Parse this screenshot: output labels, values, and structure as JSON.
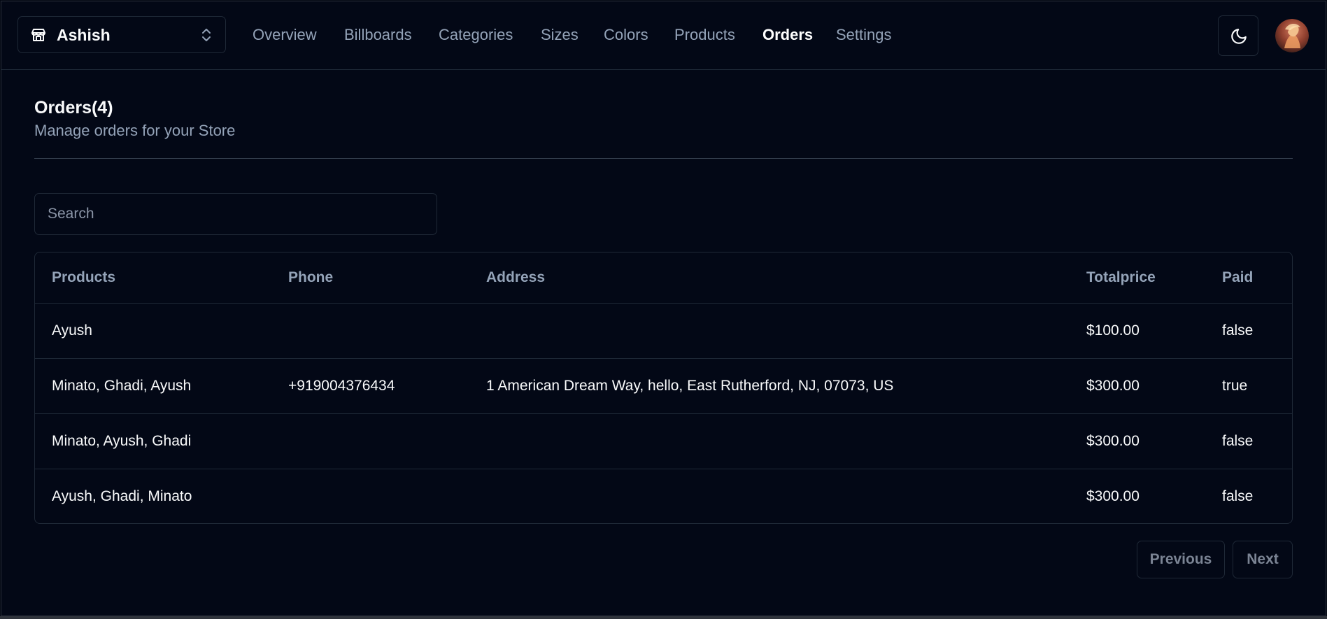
{
  "store_switcher": {
    "name": "Ashish",
    "icon": "store-icon",
    "chevron_icon": "chevrons-up-down-icon"
  },
  "nav": {
    "items": [
      {
        "label": "Overview",
        "active": false
      },
      {
        "label": "Billboards",
        "active": false
      },
      {
        "label": "Categories",
        "active": false
      },
      {
        "label": "Sizes",
        "active": false
      },
      {
        "label": "Colors",
        "active": false
      },
      {
        "label": "Products",
        "active": false
      },
      {
        "label": "Orders",
        "active": true
      },
      {
        "label": "Settings",
        "active": false
      }
    ]
  },
  "header_actions": {
    "theme_icon": "moon-icon",
    "avatar_icon": "user-avatar"
  },
  "heading": {
    "title": "Orders(4)",
    "subtitle": "Manage orders for your Store"
  },
  "search": {
    "placeholder": "Search",
    "value": ""
  },
  "table": {
    "columns": [
      "Products",
      "Phone",
      "Address",
      "Totalprice",
      "Paid"
    ],
    "rows": [
      [
        "Ayush",
        "",
        "",
        "$100.00",
        "false"
      ],
      [
        "Minato, Ghadi, Ayush",
        "+919004376434",
        "1 American Dream Way, hello, East Rutherford, NJ, 07073, US",
        "$300.00",
        "true"
      ],
      [
        "Minato, Ayush, Ghadi",
        "",
        "",
        "$300.00",
        "false"
      ],
      [
        "Ayush, Ghadi, Minato",
        "",
        "",
        "$300.00",
        "false"
      ]
    ]
  },
  "pagination": {
    "previous": "Previous",
    "next": "Next"
  },
  "colors": {
    "background": "#030816",
    "border": "#1f2937",
    "muted_text": "#94a3b8",
    "foreground": "#f9fafb"
  }
}
